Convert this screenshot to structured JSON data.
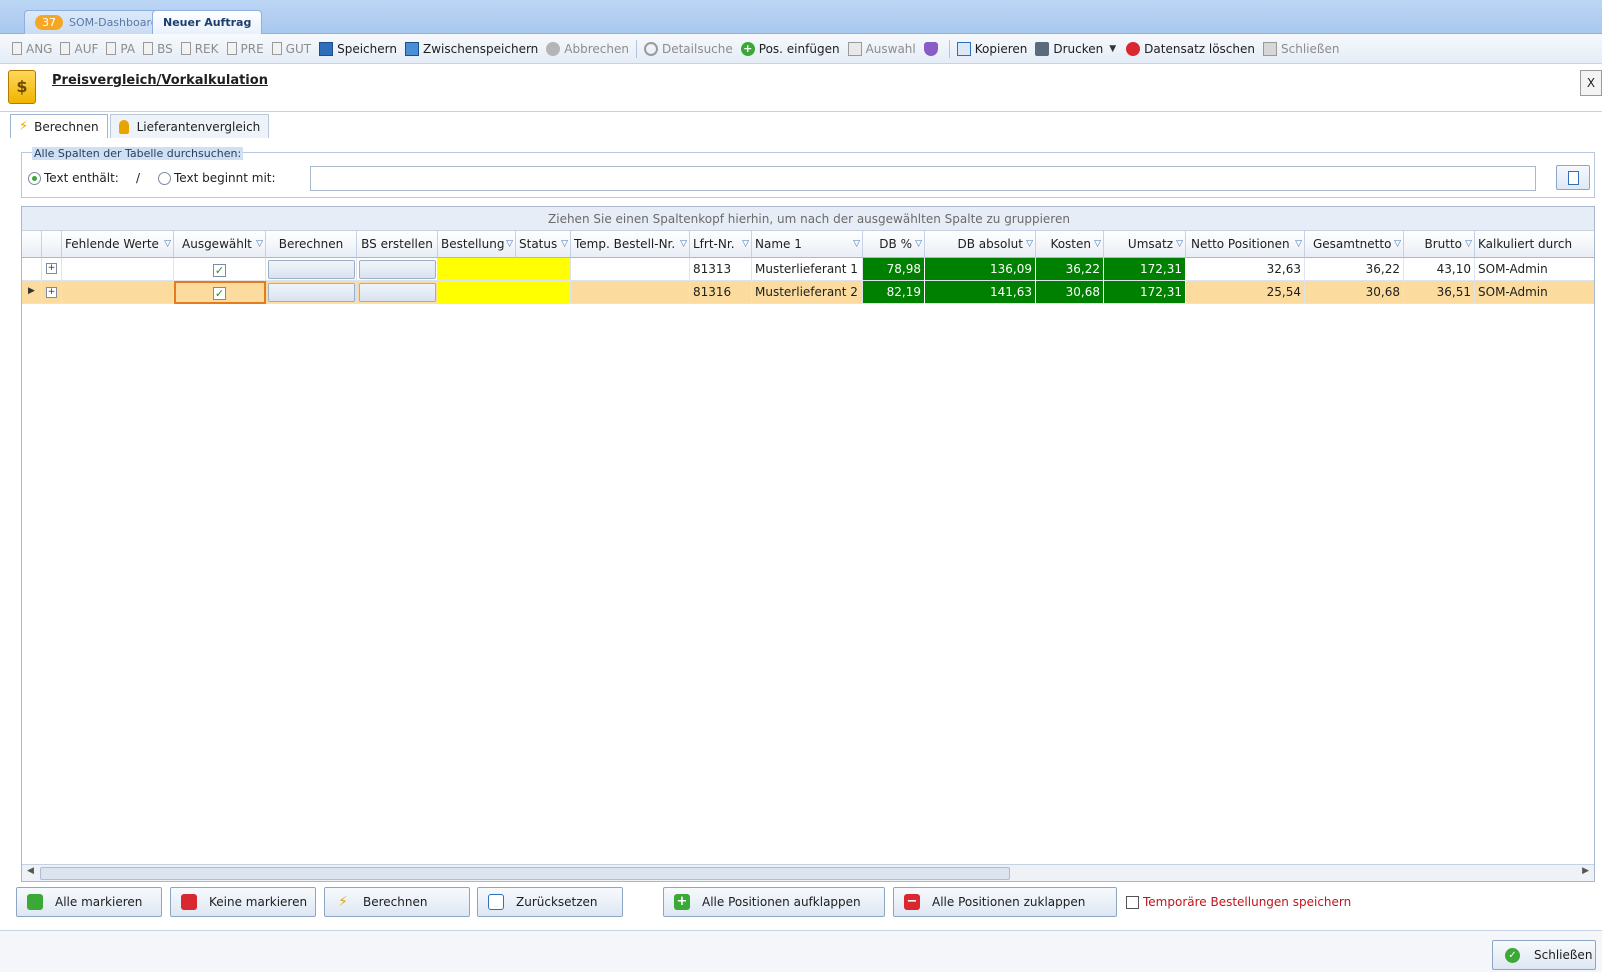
{
  "doc_tabs": [
    {
      "badge": "37",
      "label": "SOM-Dashboard"
    },
    {
      "label": "Neuer Auftrag"
    }
  ],
  "toolbar": {
    "items": [
      {
        "label": "ANG",
        "icon": "document-icon",
        "enabled": false
      },
      {
        "label": "AUF",
        "icon": "document-icon",
        "enabled": false
      },
      {
        "label": "PA",
        "icon": "document-icon",
        "enabled": false
      },
      {
        "label": "BS",
        "icon": "document-icon",
        "enabled": false
      },
      {
        "label": "REK",
        "icon": "document-icon",
        "enabled": false
      },
      {
        "label": "PRE",
        "icon": "document-icon",
        "enabled": false
      },
      {
        "label": "GUT",
        "icon": "document-icon",
        "enabled": false
      },
      {
        "label": "Speichern",
        "icon": "save-icon",
        "enabled": true
      },
      {
        "label": "Zwischenspeichern",
        "icon": "save-multiple-icon",
        "enabled": true
      },
      {
        "label": "Abbrechen",
        "icon": "cancel-icon",
        "enabled": false
      },
      {
        "label": "Detailsuche",
        "icon": "search-icon",
        "enabled": false
      },
      {
        "label": "Pos. einfügen",
        "icon": "add-icon",
        "enabled": true
      },
      {
        "label": "Auswahl",
        "icon": "selection-icon",
        "enabled": false
      },
      {
        "label": "",
        "icon": "shield-icon",
        "enabled": true
      },
      {
        "label": "Kopieren",
        "icon": "copy-icon",
        "enabled": true
      },
      {
        "label": "Drucken",
        "icon": "print-icon",
        "enabled": true
      },
      {
        "label": "Datensatz löschen",
        "icon": "delete-icon",
        "enabled": true
      },
      {
        "label": "Schließen",
        "icon": "close-window-icon",
        "enabled": false
      }
    ]
  },
  "window": {
    "title": "Preisvergleich/Vorkalkulation",
    "close_label": "X"
  },
  "inner_tabs": [
    {
      "label": "Berechnen",
      "icon": "lightning-icon"
    },
    {
      "label": "Lieferantenvergleich",
      "icon": "person-icon"
    }
  ],
  "search": {
    "legend": "Alle Spalten der Tabelle durchsuchen:",
    "option_contains": "Text enthält:",
    "separator": "/",
    "option_begins": "Text beginnt mit:",
    "value": "",
    "placeholder": ""
  },
  "grid": {
    "group_hint": "Ziehen Sie einen Spaltenkopf hierhin, um nach der ausgewählten Spalte zu gruppieren",
    "columns": [
      "Fehlende Werte",
      "Ausgewählt",
      "Berechnen",
      "BS erstellen",
      "Bestellung",
      "Status",
      "Temp. Bestell-Nr.",
      "Lfrt-Nr.",
      "Name 1",
      "DB %",
      "DB absolut",
      "Kosten",
      "Umsatz",
      "Netto Positionen",
      "Gesamtnetto",
      "Brutto",
      "Kalkuliert durch"
    ],
    "rows": [
      {
        "lfrt_nr": "81313",
        "name": "Musterlieferant 1",
        "db_pct": "78,98",
        "db_abs": "136,09",
        "kosten": "36,22",
        "umsatz": "172,31",
        "netto_pos": "32,63",
        "gesamtnetto": "36,22",
        "brutto": "43,10",
        "kalkuliert": "SOM-Admin",
        "selected": true
      },
      {
        "lfrt_nr": "81316",
        "name": "Musterlieferant 2",
        "db_pct": "82,19",
        "db_abs": "141,63",
        "kosten": "30,68",
        "umsatz": "172,31",
        "netto_pos": "25,54",
        "gesamtnetto": "30,68",
        "brutto": "36,51",
        "kalkuliert": "SOM-Admin",
        "selected": true
      }
    ]
  },
  "bottom_buttons": {
    "mark_all": "Alle markieren",
    "mark_none": "Keine markieren",
    "calculate": "Berechnen",
    "reset": "Zurücksetzen",
    "expand_all": "Alle Positionen aufklappen",
    "collapse_all": "Alle Positionen zuklappen",
    "temp_orders": "Temporäre Bestellungen speichern"
  },
  "footer": {
    "close_label": "Schließen"
  },
  "colors": {
    "positive_green": "#008000",
    "highlight_yellow": "#ffff00",
    "selected_row": "#fbdc9e",
    "temp_red": "#c0141b"
  }
}
